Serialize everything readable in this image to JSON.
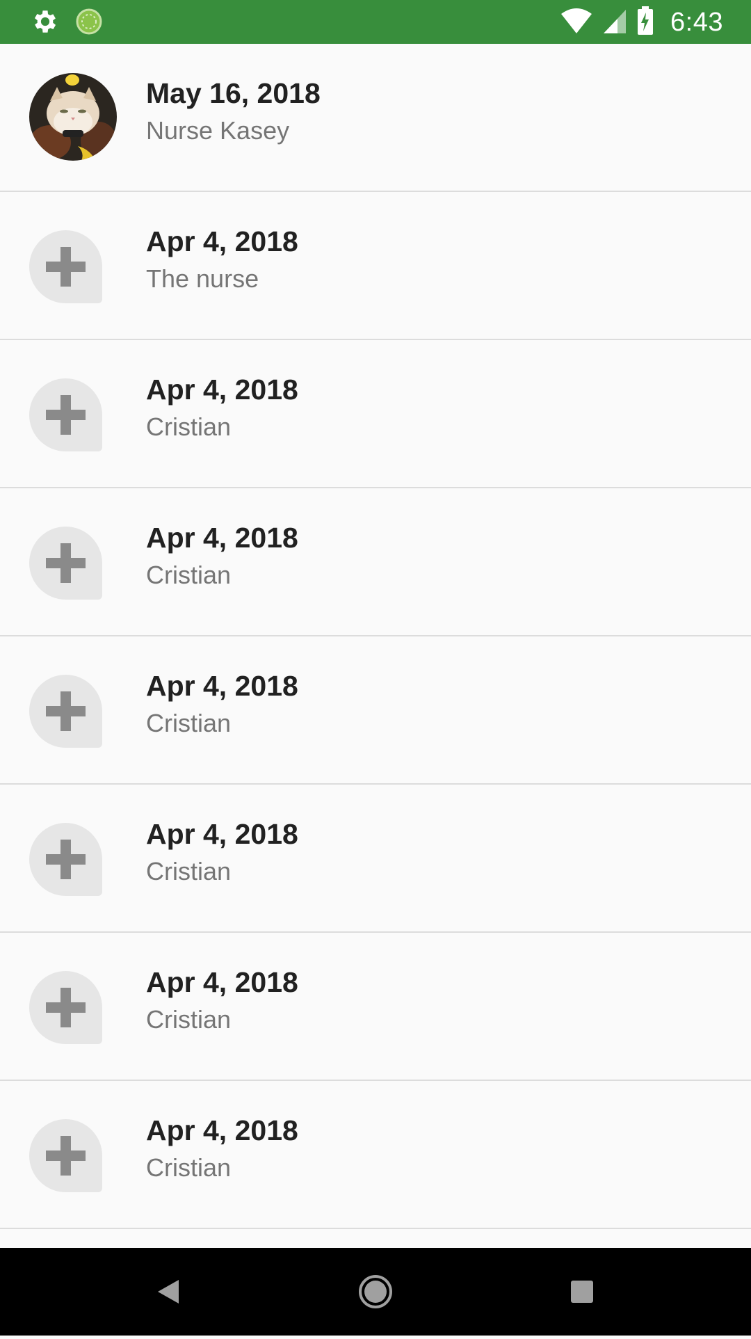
{
  "status_bar": {
    "time": "6:43",
    "background": "#388e3c",
    "icons_left": [
      "gear-icon",
      "sync-icon"
    ],
    "icons_right": [
      "wifi-icon",
      "signal-icon",
      "battery-charging-icon"
    ]
  },
  "list": {
    "items": [
      {
        "date": "May 16, 2018",
        "name": "Nurse Kasey",
        "avatar": "photo"
      },
      {
        "date": "Apr 4, 2018",
        "name": "The nurse",
        "avatar": "add-placeholder"
      },
      {
        "date": "Apr 4, 2018",
        "name": "Cristian",
        "avatar": "add-placeholder"
      },
      {
        "date": "Apr 4, 2018",
        "name": "Cristian",
        "avatar": "add-placeholder"
      },
      {
        "date": "Apr 4, 2018",
        "name": "Cristian",
        "avatar": "add-placeholder"
      },
      {
        "date": "Apr 4, 2018",
        "name": "Cristian",
        "avatar": "add-placeholder"
      },
      {
        "date": "Apr 4, 2018",
        "name": "Cristian",
        "avatar": "add-placeholder"
      },
      {
        "date": "Apr 4, 2018",
        "name": "Cristian",
        "avatar": "add-placeholder"
      }
    ]
  },
  "nav_bar": {
    "buttons": [
      "back-icon",
      "home-icon",
      "recents-icon"
    ]
  }
}
